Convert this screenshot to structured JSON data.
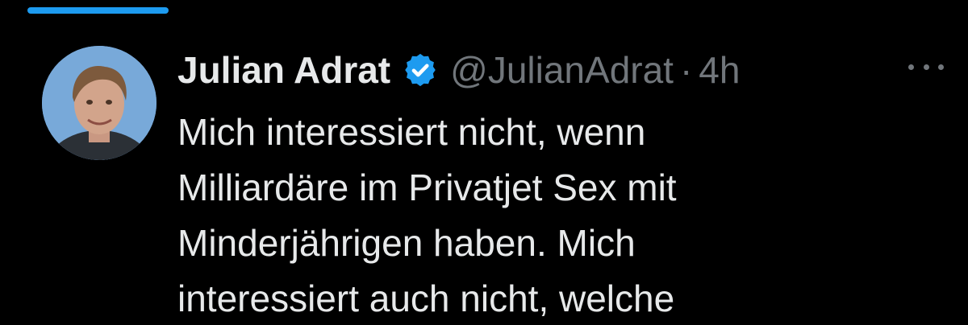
{
  "tweet": {
    "display_name": "Julian Adrat",
    "handle": "@JulianAdrat",
    "separator": "·",
    "time": "4h",
    "verified": true,
    "text_lines": [
      "Mich interessiert nicht, wenn",
      "Milliardäre im Privatjet Sex mit",
      "Minderjährigen haben. Mich",
      "interessiert auch nicht, welche"
    ],
    "icons": {
      "avatar": "profile-photo",
      "verified": "verified-badge-icon",
      "more": "more-options-icon"
    }
  },
  "colors": {
    "background": "#000000",
    "text_primary": "#e7e9ea",
    "text_secondary": "#71767b",
    "accent": "#1d9bf0"
  }
}
